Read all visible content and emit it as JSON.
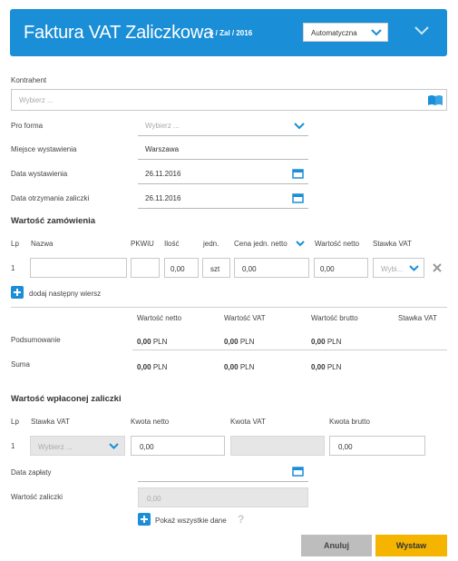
{
  "header": {
    "title": "Faktura VAT Zaliczkowa",
    "doc_number": "6 / Zal / 2016",
    "mode_value": "Automatyczna"
  },
  "contractor": {
    "label": "Kontrahent",
    "placeholder": "Wybierz ..."
  },
  "proforma": {
    "label": "Pro forma",
    "placeholder": "Wybierz ..."
  },
  "place": {
    "label": "Miejsce wystawienia",
    "value": "Warszawa"
  },
  "issue_date": {
    "label": "Data wystawienia",
    "value": "26.11.2016"
  },
  "advance_date": {
    "label": "Data otrzymania zaliczki",
    "value": "26.11.2016"
  },
  "order": {
    "heading": "Wartość zamówienia",
    "columns": {
      "lp": "Lp",
      "name": "Nazwa",
      "pkwiu": "PKWiU",
      "qty": "Ilość",
      "unit": "jedn.",
      "unit_price": "Cena jedn. netto",
      "net_value": "Wartość netto",
      "vat_rate": "Stawka VAT"
    },
    "row": {
      "lp": "1",
      "qty": "0,00",
      "unit": "szt",
      "unit_price": "0,00",
      "net_value": "0,00",
      "vat_placeholder": "Wybi..."
    },
    "add_row_label": "dodaj następny wiersz"
  },
  "summary": {
    "columns": {
      "net": "Wartość netto",
      "vat": "Wartość VAT",
      "gross": "Wartość brutto",
      "rate": "Stawka VAT"
    },
    "rows": [
      {
        "label": "Podsumowanie",
        "net": "0,00",
        "vat": "0,00",
        "gross": "0,00"
      },
      {
        "label": "Suma",
        "net": "0,00",
        "vat": "0,00",
        "gross": "0,00"
      }
    ],
    "currency": "PLN"
  },
  "advance": {
    "heading": "Wartość wpłaconej zaliczki",
    "columns": {
      "lp": "Lp",
      "vat_rate": "Stawka VAT",
      "net": "Kwota netto",
      "vat": "Kwota VAT",
      "gross": "Kwota brutto"
    },
    "row": {
      "lp": "1",
      "vat_placeholder": "Wybierz ...",
      "net": "0,00",
      "gross": "0,00"
    }
  },
  "payment_date": {
    "label": "Data zapłaty"
  },
  "advance_value": {
    "label": "Wartość zaliczki",
    "value": "0,00"
  },
  "show_all_label": "Pokaż wszystkie dane",
  "help_icon_text": "?",
  "buttons": {
    "cancel": "Anuluj",
    "issue": "Wystaw"
  },
  "colors": {
    "accent": "#1a8ed6",
    "primary_button": "#f4b400",
    "cancel_button": "#bdbdbd"
  }
}
